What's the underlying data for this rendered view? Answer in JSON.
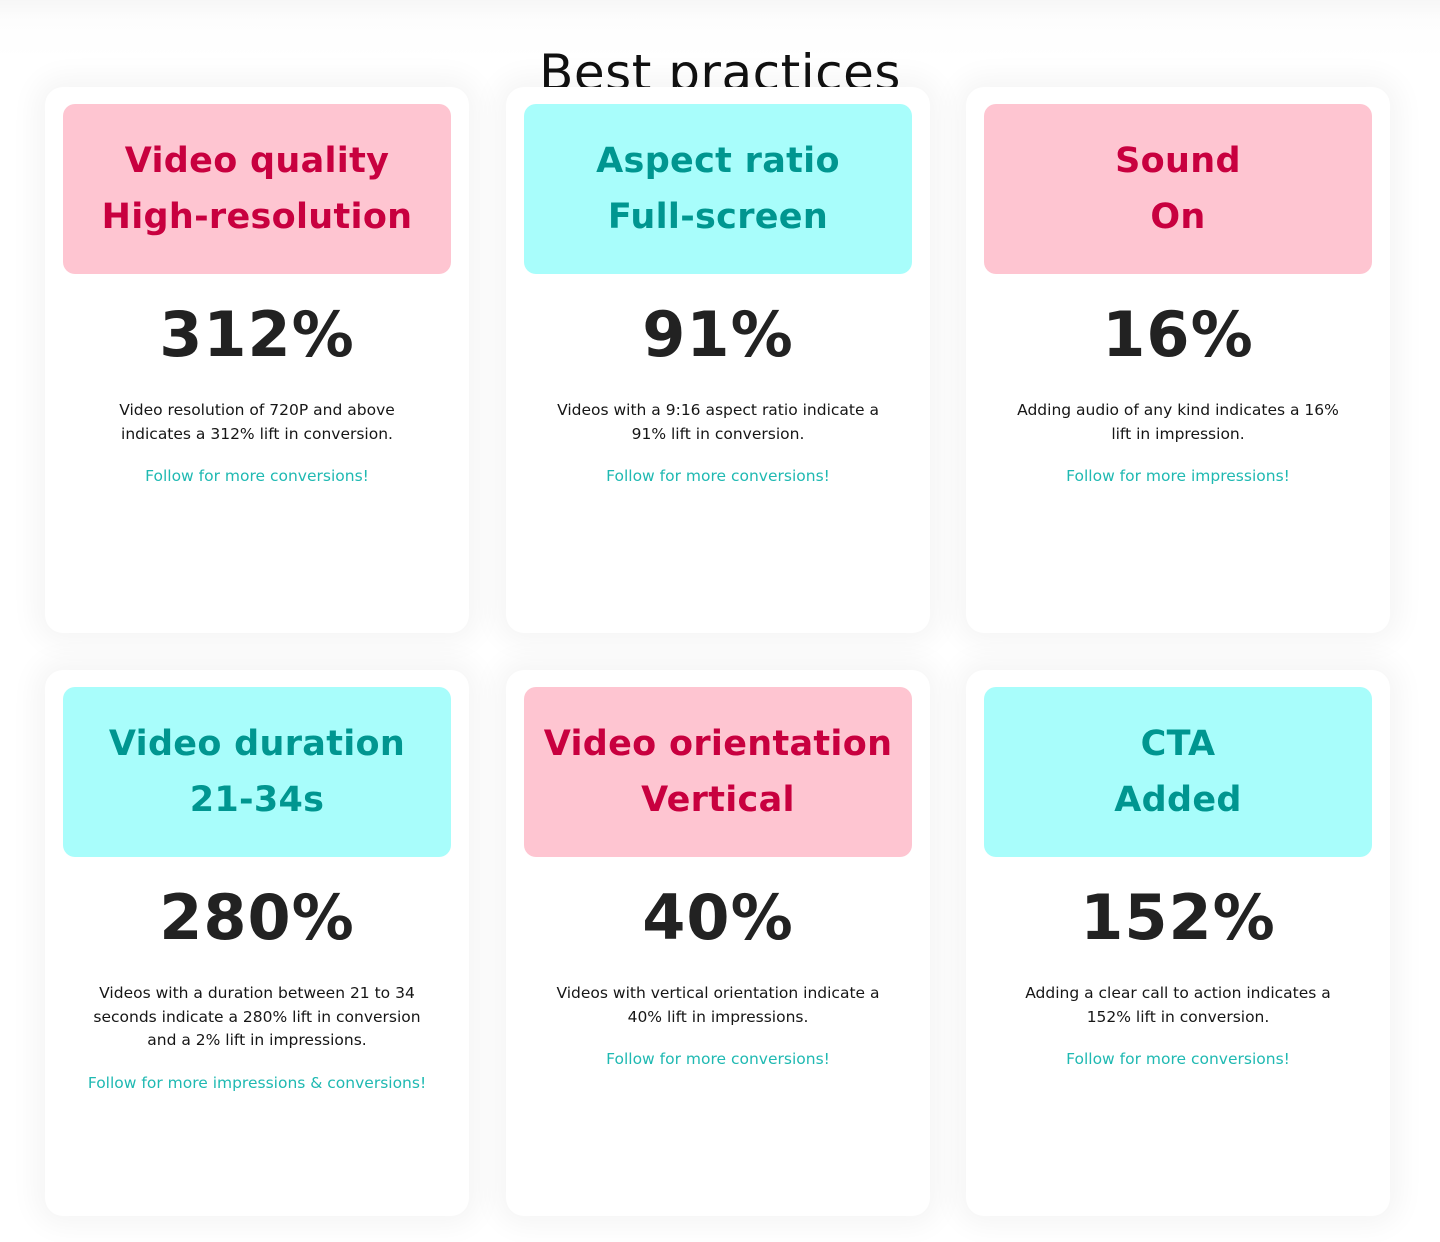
{
  "page": {
    "title": "Best practices"
  },
  "colors": {
    "pink_bg": "#fec5d1",
    "pink_text": "#c8003f",
    "cyan_bg": "#a8fdfb",
    "teal_text": "#009690",
    "link": "#1fb9b2",
    "stat": "#222222"
  },
  "cards": [
    {
      "theme": "pink",
      "title": "Video quality",
      "subtitle": "High-resolution",
      "stat": "312%",
      "description": "Video resolution of 720P and above indicates a 312% lift in conversion.",
      "cta": "Follow for more conversions!"
    },
    {
      "theme": "cyan",
      "title": "Aspect ratio",
      "subtitle": "Full-screen",
      "stat": "91%",
      "description": "Videos with a 9:16 aspect ratio indicate a 91% lift in conversion.",
      "cta": "Follow for more conversions!"
    },
    {
      "theme": "pink",
      "title": "Sound",
      "subtitle": "On",
      "stat": "16%",
      "description": "Adding audio of any kind indicates a 16% lift in impression.",
      "cta": "Follow for more impressions!"
    },
    {
      "theme": "cyan",
      "title": "Video duration",
      "subtitle": "21-34s",
      "stat": "280%",
      "description": "Videos with a duration between 21 to 34 seconds indicate a 280% lift in conversion and a 2% lift in impressions.",
      "cta": "Follow for more impressions & conversions!"
    },
    {
      "theme": "pink",
      "title": "Video orientation",
      "subtitle": "Vertical",
      "stat": "40%",
      "description": "Videos with vertical orientation indicate a 40% lift in impressions.",
      "cta": "Follow for more conversions!"
    },
    {
      "theme": "cyan",
      "title": "CTA",
      "subtitle": "Added",
      "stat": "152%",
      "description": "Adding a clear call to action indicates a 152% lift in conversion.",
      "cta": "Follow for more conversions!"
    }
  ]
}
